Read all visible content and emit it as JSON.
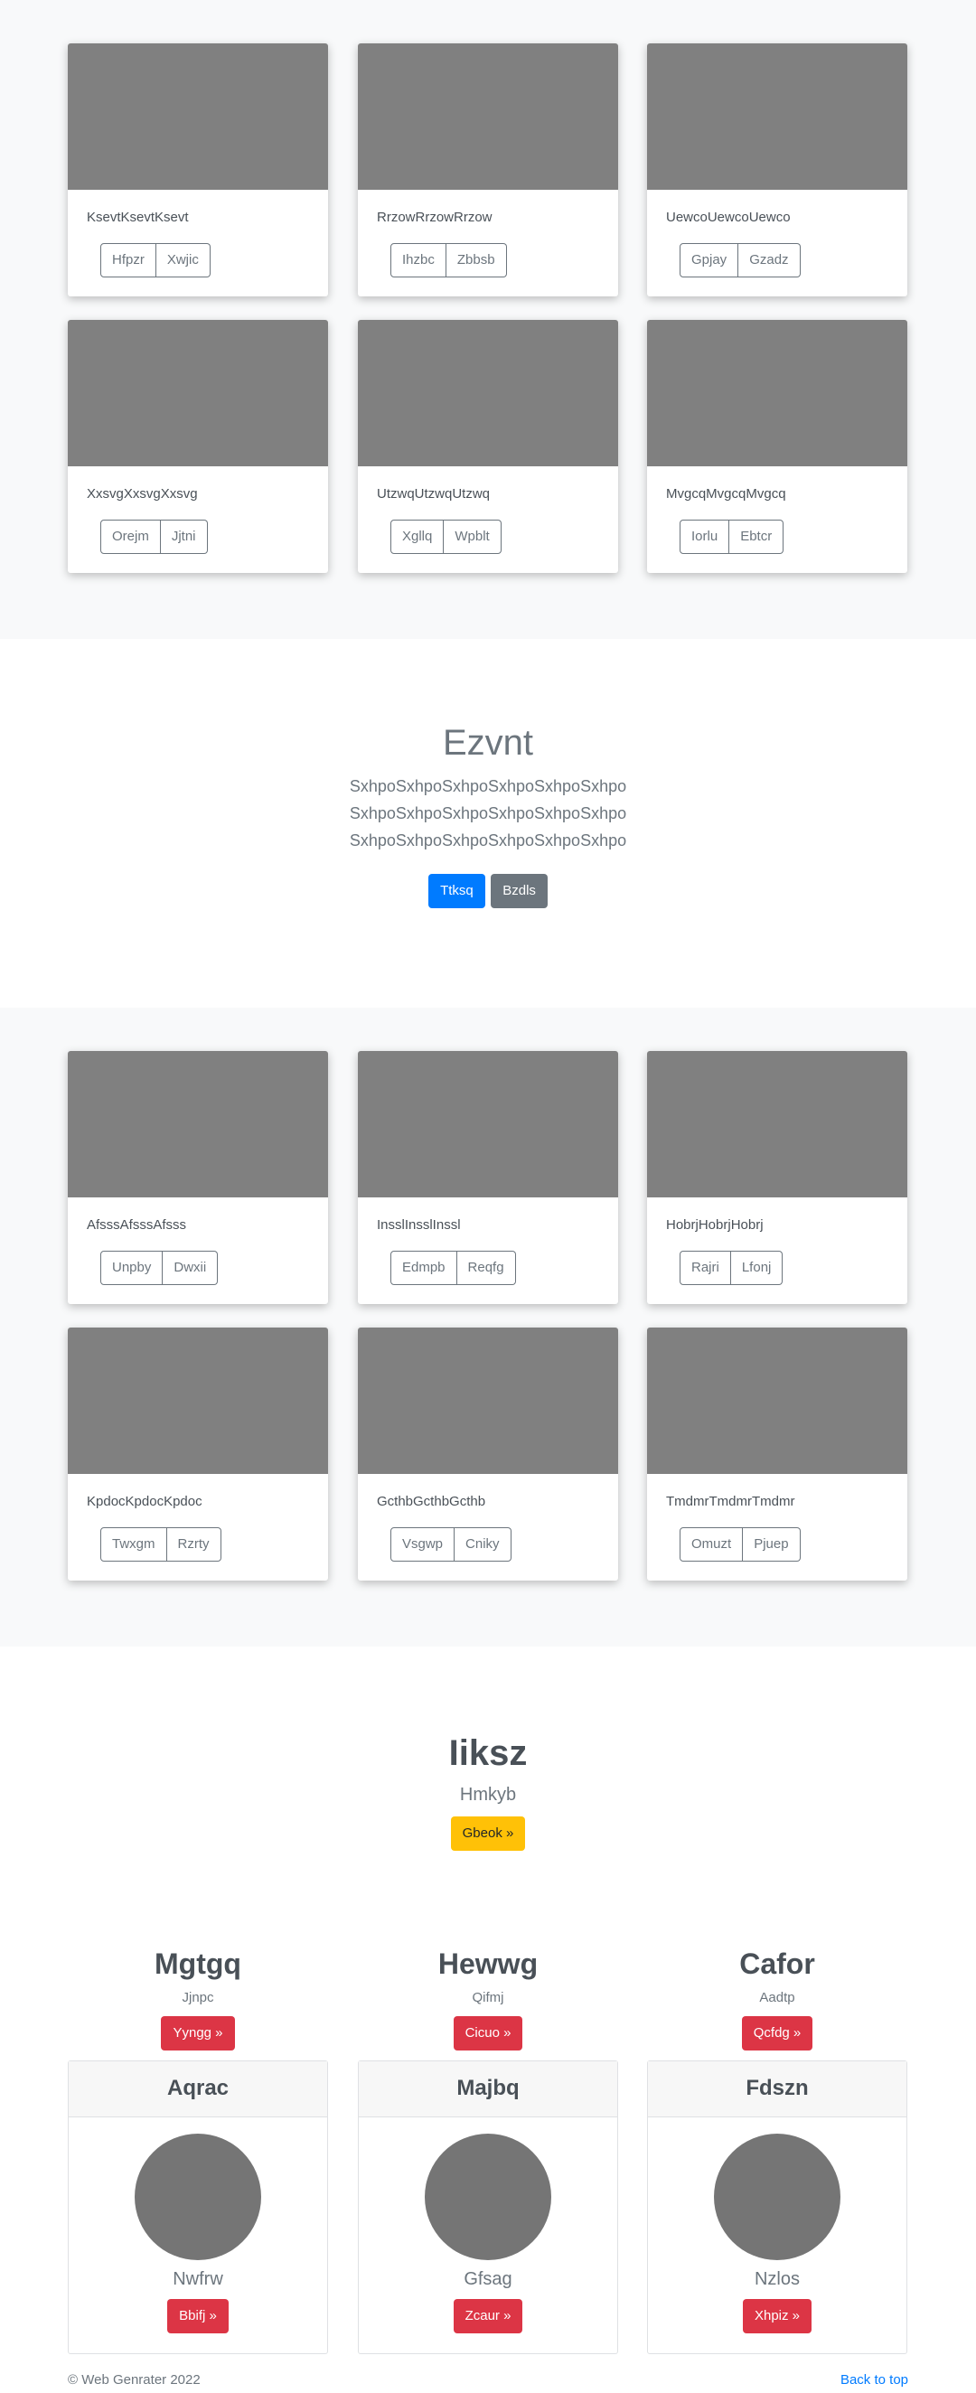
{
  "album1": [
    {
      "title": "KsevtKsevtKsevt",
      "b1": "Hfpzr",
      "b2": "Xwjic"
    },
    {
      "title": "RrzowRrzowRrzow",
      "b1": "Ihzbc",
      "b2": "Zbbsb"
    },
    {
      "title": "UewcoUewcoUewco",
      "b1": "Gpjay",
      "b2": "Gzadz"
    },
    {
      "title": "XxsvgXxsvgXxsvg",
      "b1": "Orejm",
      "b2": "Jjtni"
    },
    {
      "title": "UtzwqUtzwqUtzwq",
      "b1": "Xgllq",
      "b2": "Wpblt"
    },
    {
      "title": "MvgcqMvgcqMvgcq",
      "b1": "Iorlu",
      "b2": "Ebtcr"
    }
  ],
  "hero": {
    "title": "Ezvnt",
    "lead_lines": [
      "SxhpoSxhpoSxhpoSxhpoSxhpoSxhpo",
      "SxhpoSxhpoSxhpoSxhpoSxhpoSxhpo",
      "SxhpoSxhpoSxhpoSxhpoSxhpoSxhpo"
    ],
    "primary": "Ttksq",
    "secondary": "Bzdls"
  },
  "album2": [
    {
      "title": "AfsssAfsssAfsss",
      "b1": "Unpby",
      "b2": "Dwxii"
    },
    {
      "title": "InsslInsslInssl",
      "b1": "Edmpb",
      "b2": "Reqfg"
    },
    {
      "title": "HobrjHobrjHobrj",
      "b1": "Rajri",
      "b2": "Lfonj"
    },
    {
      "title": "KpdocKpdocKpdoc",
      "b1": "Twxgm",
      "b2": "Rzrty"
    },
    {
      "title": "GcthbGcthbGcthb",
      "b1": "Vsgwp",
      "b2": "Cniky"
    },
    {
      "title": "TmdmrTmdmrTmdmr",
      "b1": "Omuzt",
      "b2": "Pjuep"
    }
  ],
  "jumbo": {
    "title": "Iiksz",
    "subtitle": "Hmkyb",
    "button": "Gbeok »"
  },
  "columns": [
    {
      "title": "Mgtgq",
      "text": "Jjnpc",
      "button": "Yyngg »"
    },
    {
      "title": "Hewwg",
      "text": "Qifmj",
      "button": "Cicuo »"
    },
    {
      "title": "Cafor",
      "text": "Aadtp",
      "button": "Qcfdg »"
    }
  ],
  "profiles": [
    {
      "header": "Aqrac",
      "name": "Nwfrw",
      "button": "Bbifj »"
    },
    {
      "header": "Majbq",
      "name": "Gfsag",
      "button": "Zcaur »"
    },
    {
      "header": "Fdszn",
      "name": "Nzlos",
      "button": "Xhpiz »"
    }
  ],
  "footer": {
    "copyright": "© Web Genrater 2022",
    "back_to_top": "Back to top"
  },
  "colors": {
    "primary": "#007bff",
    "secondary": "#6c757d",
    "warning": "#ffc107",
    "danger": "#dc3545",
    "placeholder": "#808080"
  }
}
